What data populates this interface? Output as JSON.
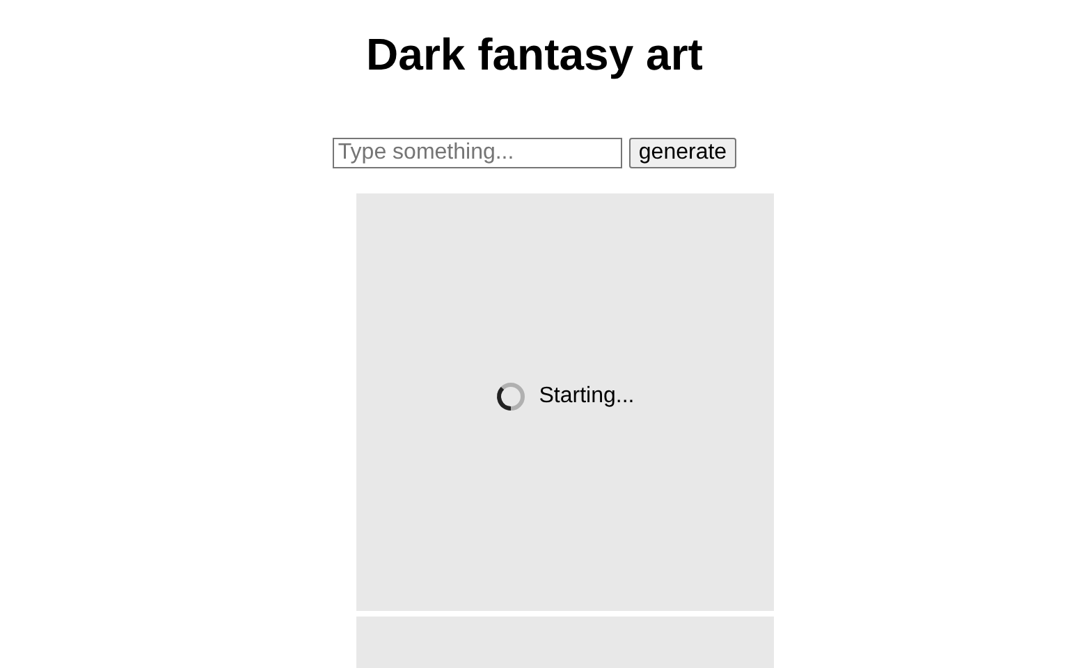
{
  "title": "Dark fantasy art",
  "search": {
    "placeholder": "Type something..."
  },
  "button": "generate",
  "cards": [
    {
      "kind": "loading",
      "status": "Starting..."
    },
    {
      "kind": "empty"
    }
  ]
}
